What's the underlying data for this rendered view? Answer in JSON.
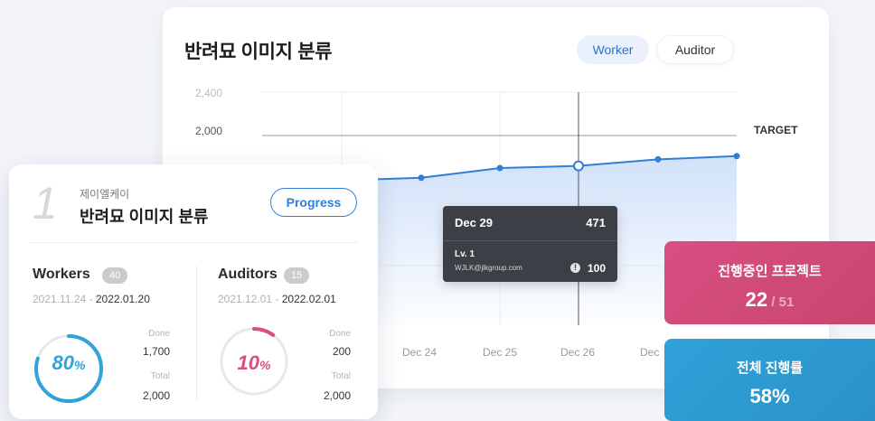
{
  "chart": {
    "title": "반려묘 이미지 분류",
    "toggle": {
      "worker_label": "Worker",
      "auditor_label": "Auditor",
      "active": "Worker"
    },
    "target_label": "TARGET",
    "colors": {
      "line": "#2f7fd9",
      "area": "#cfe0f8",
      "target_line": "#9a9a9a",
      "grid": "#eeeeee"
    }
  },
  "chart_data": {
    "type": "area",
    "y_ticks": [
      "2,400",
      "2,000"
    ],
    "ylim": [
      0,
      2400
    ],
    "target": 2000,
    "x_tick_labels": [
      "Dec 24",
      "Dec 25",
      "Dec 26",
      "Dec"
    ],
    "series": [
      {
        "values": [
          1580,
          1610,
          1700,
          1720,
          1780,
          1810
        ]
      }
    ],
    "highlight_index": 3,
    "grid": true
  },
  "tooltip": {
    "date": "Dec 29",
    "value": "471",
    "level": "Lv. 1",
    "email": "WJLK@jlkgroup.com",
    "alert_icon": "!",
    "count": "100"
  },
  "project": {
    "rank": "1",
    "company": "제이엘케이",
    "name": "반려묘 이미지 분류",
    "progress_label": "Progress",
    "workers": {
      "label": "Workers",
      "count": "40",
      "start": "2021.11.24",
      "separator": " - ",
      "end": "2022.01.20",
      "percent": "80",
      "percent_unit": "%",
      "ratio": 0.8,
      "color": "#2fa2d9",
      "done_label": "Done",
      "done": "1,700",
      "total_label": "Total",
      "total": "2,000"
    },
    "auditors": {
      "label": "Auditors",
      "count": "15",
      "start": "2021.12.01",
      "separator": " - ",
      "end": "2022.02.01",
      "percent": "10",
      "percent_unit": "%",
      "ratio": 0.1,
      "color": "#d84f7a",
      "done_label": "Done",
      "done": "200",
      "total_label": "Total",
      "total": "2,000"
    }
  },
  "stats": {
    "ongoing": {
      "label": "진행중인 프로젝트",
      "value": "22",
      "separator": " / ",
      "total": "51",
      "color": "#d84f82"
    },
    "overall": {
      "label": "전체 진행률",
      "value": "58%",
      "color": "#2fa2d9"
    }
  }
}
